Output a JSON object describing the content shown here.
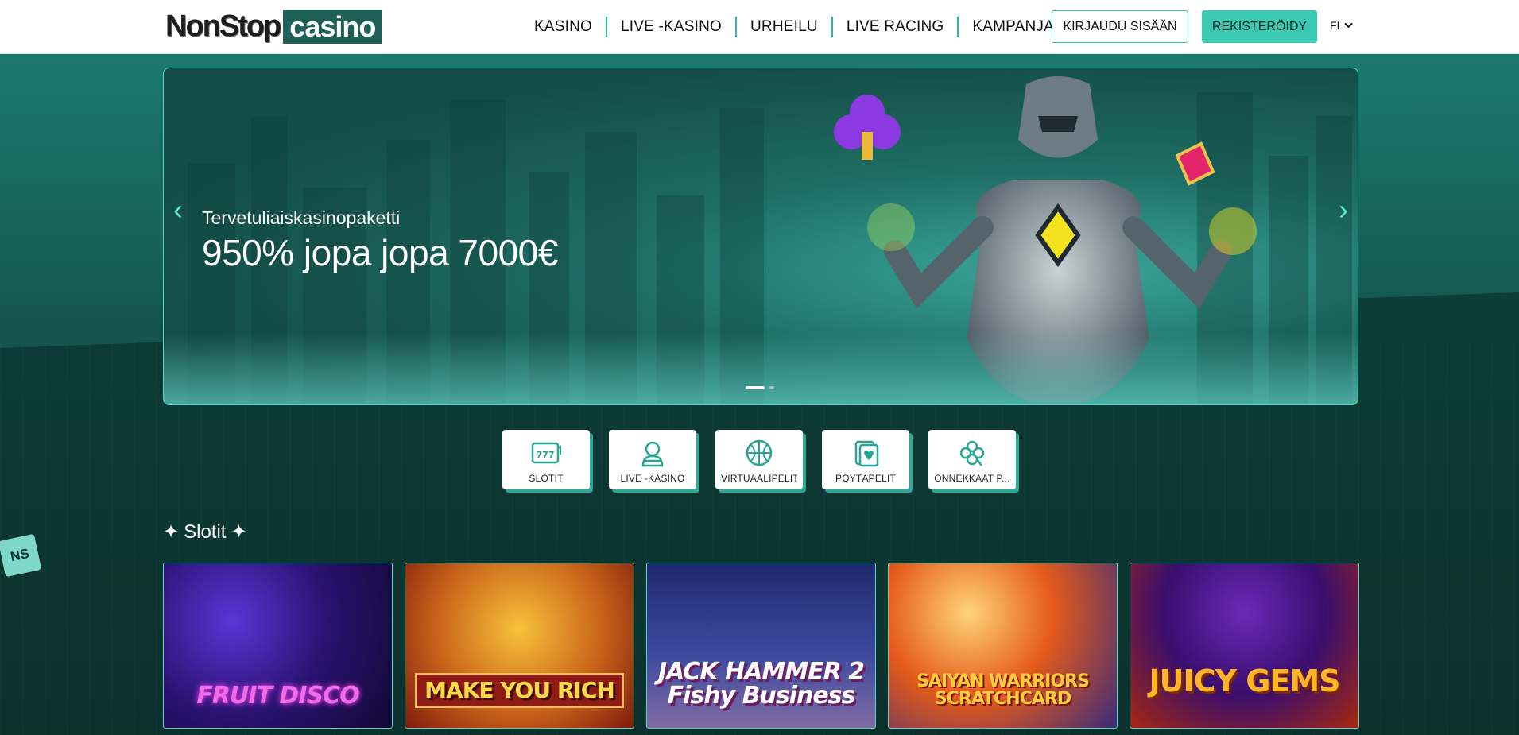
{
  "header": {
    "logo": {
      "part1": "NonStop",
      "part2": "casino"
    },
    "nav": [
      "KASINO",
      "LIVE -KASINO",
      "URHEILU",
      "LIVE RACING",
      "KAMPANJAT"
    ],
    "login_label": "KIRJAUDU SISÄÄN",
    "register_label": "REKISTERÖIDY",
    "language": "FI"
  },
  "hero": {
    "subtitle": "Tervetuliaiskasinopaketti",
    "title": "950% jopa jopa 7000€",
    "slides": 2,
    "active_slide": 1
  },
  "categories": [
    {
      "label": "SLOTIT",
      "icon": "slot-777-icon"
    },
    {
      "label": "LIVE -KASINO",
      "icon": "dealer-icon"
    },
    {
      "label": "VIRTUAALIPELIT",
      "icon": "basketball-icon"
    },
    {
      "label": "PÖYTÄPELIT",
      "icon": "cards-icon"
    },
    {
      "label": "ONNEKKAAT P...",
      "icon": "clover-icon"
    }
  ],
  "section": {
    "title": "Slotit",
    "badge": "NS"
  },
  "games": [
    {
      "name": "FRUIT DISCO"
    },
    {
      "name": "MAKE YOU RICH"
    },
    {
      "name": "JACK HAMMER 2 Fishy Business"
    },
    {
      "name": "SAIYAN WARRIORS SCRATCHCARD"
    },
    {
      "name": "JUICY GEMS"
    }
  ],
  "colors": {
    "accent": "#3cc9b4",
    "dark_bg": "#0c3833",
    "header_bg": "#ffffff"
  }
}
